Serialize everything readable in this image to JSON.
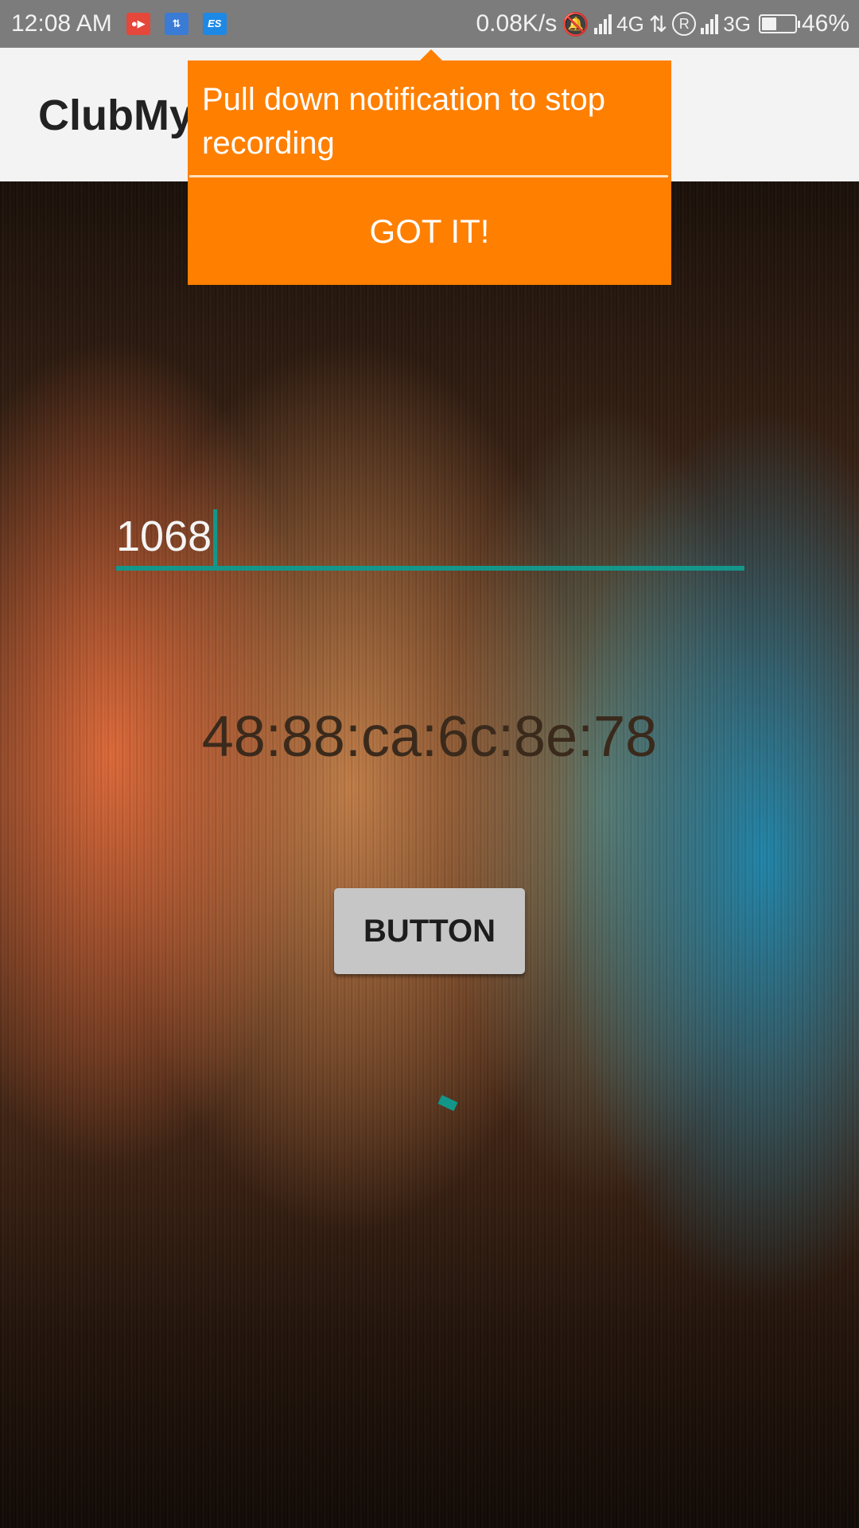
{
  "status_bar": {
    "time": "12:08 AM",
    "net_speed": "0.08K/s",
    "network_1": "4G",
    "network_2": "3G",
    "roaming": "R",
    "battery_percent": "46%",
    "battery_level": 0.46,
    "app_icons": [
      "screen-recorder-icon",
      "sync-icon",
      "es-file-explorer-icon"
    ],
    "es_label": "ES"
  },
  "app_bar": {
    "title": "ClubMy"
  },
  "tooltip": {
    "message": "Pull down notification to stop recording",
    "dismiss_label": "GOT IT!",
    "color": "#ff7f00"
  },
  "form": {
    "input_value": "1068",
    "accent_color": "#12968a"
  },
  "mac_address": "48:88:ca:6c:8e:78",
  "button_label": "BUTTON"
}
